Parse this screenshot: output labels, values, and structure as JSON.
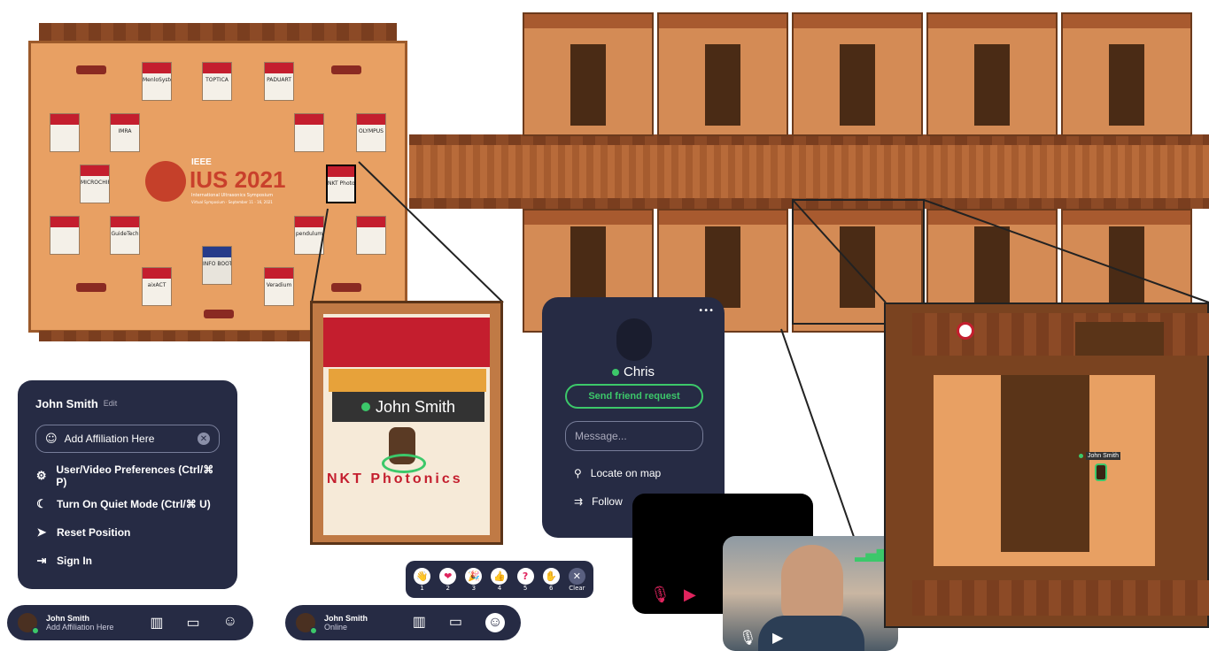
{
  "exhibit_hall": {
    "logo_main": "IUS 2021",
    "logo_ieee": "IEEE",
    "logo_sub": "International Ultrasonics Symposium",
    "logo_dates": "Virtual Symposium · September 11 - 16, 2021",
    "booths": [
      "MenloSystems",
      "TOPTICA",
      "PADUART",
      "NKT Photonics",
      "IMRA",
      "OLYMPUS",
      "MICROCHIP",
      "GuideTech",
      "pendulum",
      "INFO BOOTH",
      "aixACT",
      "Veradium"
    ]
  },
  "zoom_booth": {
    "player_name": "John Smith",
    "booth_brand": "NKT Photonics"
  },
  "profile_menu": {
    "name": "John Smith",
    "edit_label": "Edit",
    "affiliation_placeholder": "Add Affiliation Here",
    "items": [
      {
        "icon": "gear-icon",
        "label": "User/Video Preferences (Ctrl/⌘ P)"
      },
      {
        "icon": "moon-icon",
        "label": "Turn On Quiet Mode (Ctrl/⌘ U)"
      },
      {
        "icon": "location-arrow-icon",
        "label": "Reset Position"
      },
      {
        "icon": "sign-in-icon",
        "label": "Sign In"
      }
    ]
  },
  "bottom_bar_1": {
    "name": "John Smith",
    "status": "Add Affiliation Here"
  },
  "bottom_bar_2": {
    "name": "John Smith",
    "status": "Online"
  },
  "emote_bar": {
    "emotes": [
      {
        "glyph": "👋",
        "key": "1"
      },
      {
        "glyph": "❤",
        "key": "2"
      },
      {
        "glyph": "🎉",
        "key": "3"
      },
      {
        "glyph": "👍",
        "key": "4"
      },
      {
        "glyph": "?",
        "key": "5"
      },
      {
        "glyph": "✋",
        "key": "6"
      }
    ],
    "clear_label": "Clear"
  },
  "user_card": {
    "name": "Chris",
    "friend_button": "Send friend request",
    "message_placeholder": "Message...",
    "locate_label": "Locate on map",
    "follow_label": "Follow",
    "more": "•••"
  },
  "room_zoom": {
    "player_name": "John Smith"
  },
  "colors": {
    "panel": "#262b44",
    "accent_green": "#3cc86a",
    "muted_red": "#e0245e"
  }
}
